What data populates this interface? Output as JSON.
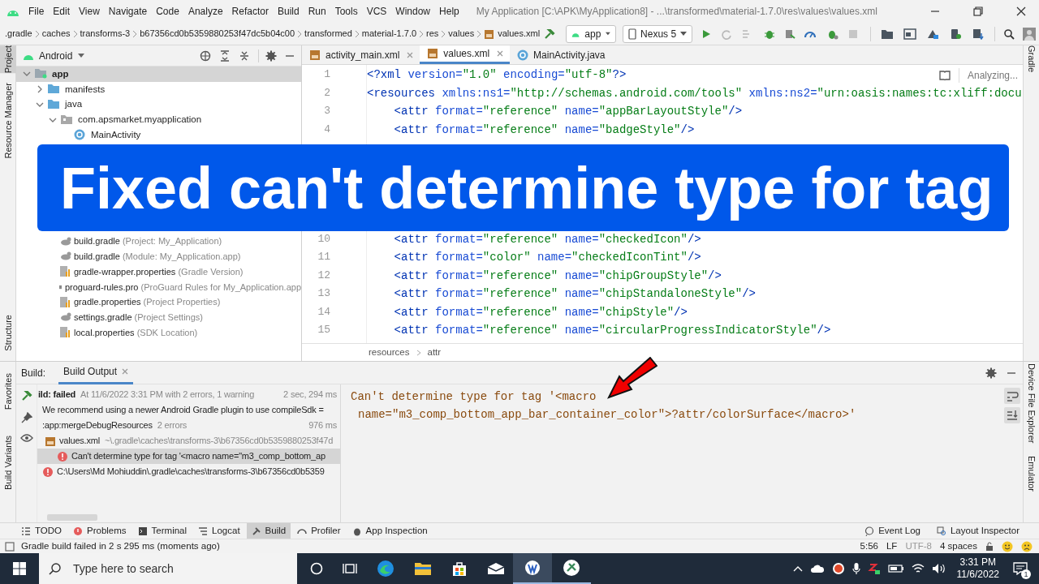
{
  "menu": [
    "File",
    "Edit",
    "View",
    "Navigate",
    "Code",
    "Analyze",
    "Refactor",
    "Build",
    "Run",
    "Tools",
    "VCS",
    "Window",
    "Help"
  ],
  "window_title": "My Application [C:\\APK\\MyApplication8] - ...\\transformed\\material-1.7.0\\res\\values\\values.xml",
  "breadcrumbs": [
    ".gradle",
    "caches",
    "transforms-3",
    "b67356cd0b5359880253f47dc5b04c00",
    "transformed",
    "material-1.7.0",
    "res",
    "values",
    "values.xml"
  ],
  "run_config": "app",
  "device": "Nexus 5",
  "left_tool_windows": [
    {
      "label": "Project",
      "selected": true
    },
    {
      "label": "Resource Manager",
      "selected": false
    }
  ],
  "left_tool_windows_lower": [
    {
      "label": "Structure",
      "selected": false
    }
  ],
  "build_side_tabs": [
    {
      "label": "Favorites",
      "selected": false
    },
    {
      "label": "Build Variants",
      "selected": false
    }
  ],
  "right_tool_windows": [
    "Gradle"
  ],
  "build_right_tabs": [
    "Device File Explorer",
    "Emulator"
  ],
  "project_panel": {
    "view": "Android",
    "tree": [
      {
        "name": "app",
        "kind": "module",
        "expanded": true,
        "selected": true,
        "children": [
          {
            "name": "manifests",
            "kind": "folder",
            "expanded": false,
            "selected": false
          },
          {
            "name": "java",
            "kind": "folder",
            "expanded": true,
            "selected": false,
            "children": [
              {
                "name": "com.apsmarket.myapplication",
                "kind": "package",
                "expanded": true,
                "selected": false,
                "children": [
                  {
                    "name": "MainActivity",
                    "kind": "class",
                    "selected": false
                  }
                ]
              }
            ]
          }
        ]
      }
    ],
    "gradle_scripts": [
      {
        "name": "build.gradle",
        "note": "(Project: My_Application)",
        "kind": "gradle"
      },
      {
        "name": "build.gradle",
        "note": "(Module: My_Application.app)",
        "kind": "gradle"
      },
      {
        "name": "gradle-wrapper.properties",
        "note": "(Gradle Version)",
        "kind": "properties"
      },
      {
        "name": "proguard-rules.pro",
        "note": "(ProGuard Rules for My_Application.app",
        "kind": "proguard"
      },
      {
        "name": "gradle.properties",
        "note": "(Project Properties)",
        "kind": "properties"
      },
      {
        "name": "settings.gradle",
        "note": "(Project Settings)",
        "kind": "gradle"
      },
      {
        "name": "local.properties",
        "note": "(SDK Location)",
        "kind": "properties"
      }
    ]
  },
  "editor": {
    "tabs": [
      {
        "label": "activity_main.xml",
        "kind": "xml",
        "selected": false,
        "closable": true
      },
      {
        "label": "values.xml",
        "kind": "xml",
        "selected": true,
        "closable": true
      },
      {
        "label": "MainActivity.java",
        "kind": "class",
        "selected": false,
        "closable": false
      }
    ],
    "status": "Analyzing...",
    "lines_top": [
      {
        "number": "1",
        "code": "<?xml version=\"1.0\" encoding=\"utf-8\"?>"
      },
      {
        "number": "2",
        "code": "<resources xmlns:ns1=\"http://schemas.android.com/tools\" xmlns:ns2=\"urn:oasis:names:tc:xliff:docu"
      },
      {
        "number": "3",
        "code": "    <attr format=\"reference\" name=\"appBarLayoutStyle\"/>"
      },
      {
        "number": "4",
        "code": "    <attr format=\"reference\" name=\"badgeStyle\"/>"
      }
    ],
    "lines_bottom": [
      {
        "number": "10",
        "code": "    <attr format=\"reference\" name=\"checkedIcon\"/>"
      },
      {
        "number": "11",
        "code": "    <attr format=\"color\" name=\"checkedIconTint\"/>"
      },
      {
        "number": "12",
        "code": "    <attr format=\"reference\" name=\"chipGroupStyle\"/>"
      },
      {
        "number": "13",
        "code": "    <attr format=\"reference\" name=\"chipStandaloneStyle\"/>"
      },
      {
        "number": "14",
        "code": "    <attr format=\"reference\" name=\"chipStyle\"/>"
      },
      {
        "number": "15",
        "code": "    <attr format=\"reference\" name=\"circularProgressIndicatorStyle\"/>"
      }
    ],
    "breadcrumb": [
      "resources",
      "attr"
    ]
  },
  "build": {
    "label": "Build:",
    "tab": "Build Output",
    "tree": [
      {
        "kind": "status",
        "text": "ild: failed",
        "note": "At 11/6/2022 3:31 PM with 2 errors, 1 warning",
        "time": "2 sec, 294 ms",
        "selected": false,
        "children": [
          {
            "kind": "warning",
            "text": "We recommend using a newer Android Gradle plugin to use compileSdk =",
            "selected": false
          },
          {
            "kind": "task",
            "text": ":app:mergeDebugResources",
            "note": "2 errors",
            "time": "976 ms",
            "selected": false,
            "children": [
              {
                "kind": "file",
                "text": "values.xml",
                "note": "~\\.gradle\\caches\\transforms-3\\b67356cd0b5359880253f47d",
                "selected": false,
                "children": [
                  {
                    "kind": "error",
                    "text": "Can't determine type for tag '<macro name=\"m3_comp_bottom_ap",
                    "selected": true
                  }
                ]
              }
            ]
          },
          {
            "kind": "error",
            "text": "C:\\Users\\Md Mohiuddin\\.gradle\\caches\\transforms-3\\b67356cd0b5359",
            "selected": false
          }
        ]
      }
    ],
    "output": [
      "Can't determine type for tag '<macro",
      "name=\"m3_comp_bottom_app_bar_container_color\">?attr/colorSurface</macro>'"
    ]
  },
  "tool_tabs": [
    {
      "label": "TODO",
      "selected": false
    },
    {
      "label": "Problems",
      "selected": false
    },
    {
      "label": "Terminal",
      "selected": false
    },
    {
      "label": "Logcat",
      "selected": false
    },
    {
      "label": "Build",
      "selected": true
    },
    {
      "label": "Profiler",
      "selected": false
    },
    {
      "label": "App Inspection",
      "selected": false
    }
  ],
  "tool_tabs_right": [
    "Event Log",
    "Layout Inspector"
  ],
  "status_bar": {
    "message": "Gradle build failed in 2 s 295 ms (moments ago)",
    "position": "5:56",
    "line_ending": "LF",
    "encoding": "UTF-8",
    "indent": "4 spaces"
  },
  "taskbar": {
    "search_placeholder": "Type here to search",
    "time": "3:31 PM",
    "date": "11/6/2022",
    "notifications": "1"
  },
  "banner": {
    "text": "Fixed can't determine type for tag"
  }
}
